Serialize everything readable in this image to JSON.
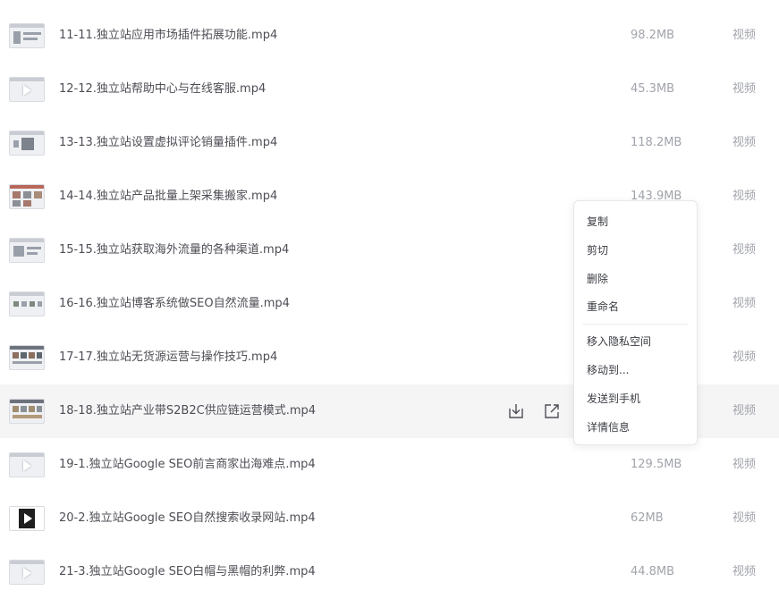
{
  "files": [
    {
      "name": "11-11.独立站应用市场插件拓展功能.mp4",
      "size": "98.2MB",
      "type": "视频",
      "thumb": "screen"
    },
    {
      "name": "12-12.独立站帮助中心与在线客服.mp4",
      "size": "45.3MB",
      "type": "视频",
      "thumb": "light-play"
    },
    {
      "name": "13-13.独立站设置虚拟评论销量插件.mp4",
      "size": "118.2MB",
      "type": "视频",
      "thumb": "screen-center"
    },
    {
      "name": "14-14.独立站产品批量上架采集搬家.mp4",
      "size": "143.9MB",
      "type": "视频",
      "thumb": "grid"
    },
    {
      "name": "15-15.独立站获取海外流量的各种渠道.mp4",
      "size": "",
      "type": "视频",
      "thumb": "screen"
    },
    {
      "name": "16-16.独立站博客系统做SEO自然流量.mp4",
      "size": "",
      "type": "视频",
      "thumb": "grid"
    },
    {
      "name": "17-17.独立站无货源运营与操作技巧.mp4",
      "size": "",
      "type": "视频",
      "thumb": "grid"
    },
    {
      "name": "18-18.独立站产业带S2B2C供应链运营模式.mp4",
      "size": "",
      "type": "视频",
      "thumb": "grid"
    },
    {
      "name": "19-1.独立站Google SEO前言商家出海难点.mp4",
      "size": "129.5MB",
      "type": "视频",
      "thumb": "light-play"
    },
    {
      "name": "20-2.独立站Google SEO自然搜索收录网站.mp4",
      "size": "62MB",
      "type": "视频",
      "thumb": "dark-play"
    },
    {
      "name": "21-3.独立站Google SEO白帽与黑帽的利弊.mp4",
      "size": "44.8MB",
      "type": "视频",
      "thumb": "light-play"
    }
  ],
  "row_actions": {
    "download_icon": "download-icon",
    "share_icon": "share-icon"
  },
  "context_menu": {
    "items": [
      {
        "label": "复制"
      },
      {
        "label": "剪切"
      },
      {
        "label": "删除"
      },
      {
        "label": "重命名"
      },
      {
        "label": "移入隐私空间"
      },
      {
        "label": "移动到..."
      },
      {
        "label": "发送到手机"
      },
      {
        "label": "详情信息"
      }
    ]
  },
  "colors": {
    "hover_row": "#f5f5f6",
    "text_primary": "#4e4e56",
    "text_secondary": "#a1a4ab"
  }
}
